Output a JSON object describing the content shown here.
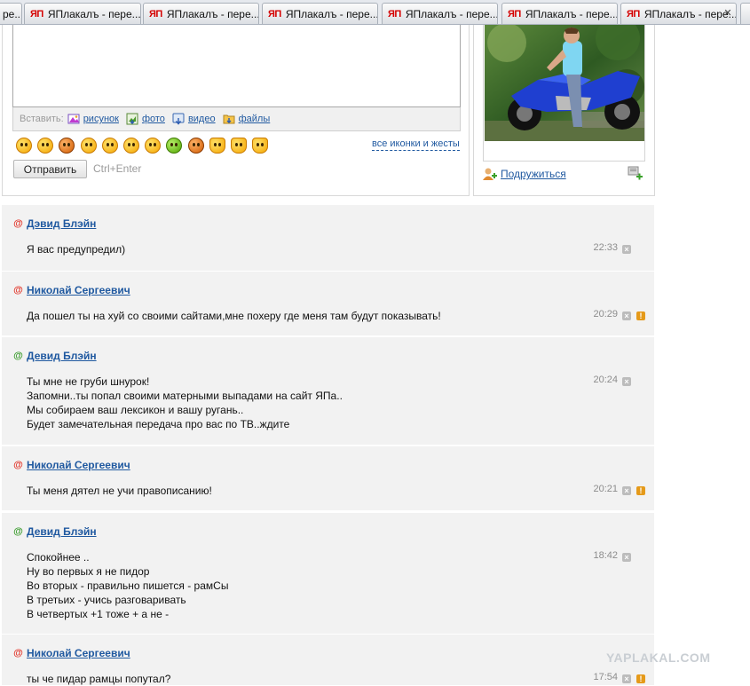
{
  "tabs": [
    {
      "label": "ре..."
    },
    {
      "label": "ЯПлакалъ - пере..."
    },
    {
      "label": "ЯПлакалъ - пере..."
    },
    {
      "label": "ЯПлакалъ - пере..."
    },
    {
      "label": "ЯПлакалъ - пере..."
    },
    {
      "label": "ЯПлакалъ - пере..."
    },
    {
      "label": "ЯПлакалъ - пере..."
    }
  ],
  "tab_logo": "ЯП",
  "compose": {
    "insert_label": "Вставить:",
    "insert_items": [
      {
        "label": "рисунок",
        "icon": "picture-icon"
      },
      {
        "label": "фото",
        "icon": "photo-icon"
      },
      {
        "label": "видео",
        "icon": "video-icon"
      },
      {
        "label": "файлы",
        "icon": "files-icon"
      }
    ],
    "all_icons_label": "все иконки и жесты",
    "send_label": "Отправить",
    "shortcut": "Ctrl+Enter"
  },
  "profile": {
    "friend_label": "Подружиться"
  },
  "messages": [
    {
      "author": "Дэвид Блэйн",
      "online": false,
      "time": "22:33",
      "lines": [
        "Я вас предупредил)"
      ],
      "warn": false
    },
    {
      "author": "Николай Сергеевич",
      "online": false,
      "time": "20:29",
      "lines": [
        "Да пошел ты на хуй со своими сайтами,мне похеру где меня там будут показывать!"
      ],
      "warn": true
    },
    {
      "author": "Девид Блэйн",
      "online": true,
      "time": "20:24",
      "lines": [
        "Ты мне не груби шнурок!",
        "Запомни..ты попал своими матерными выпадами на сайт ЯПа..",
        "Мы собираем ваш лексикон и вашу ругань..",
        "Будет замечательная передача про вас по ТВ..ждите"
      ],
      "warn": false
    },
    {
      "author": "Николай Сергеевич",
      "online": false,
      "time": "20:21",
      "lines": [
        "Ты меня дятел не учи правописанию!"
      ],
      "warn": true
    },
    {
      "author": "Девид Блэйн",
      "online": true,
      "time": "18:42",
      "lines": [
        "Спокойнее ..",
        "Ну во первых я не пидор",
        "Во вторых - правильно пишется - рамСы",
        "В третьих - учись разговаривать",
        "В четвертых +1 тоже + а не -"
      ],
      "warn": false
    },
    {
      "author": "Николай Сергеевич",
      "online": false,
      "time": "17:54",
      "lines": [
        "ты че пидар рамцы попутал?"
      ],
      "warn": true
    }
  ],
  "watermark": "YAPLAKAL.COM"
}
